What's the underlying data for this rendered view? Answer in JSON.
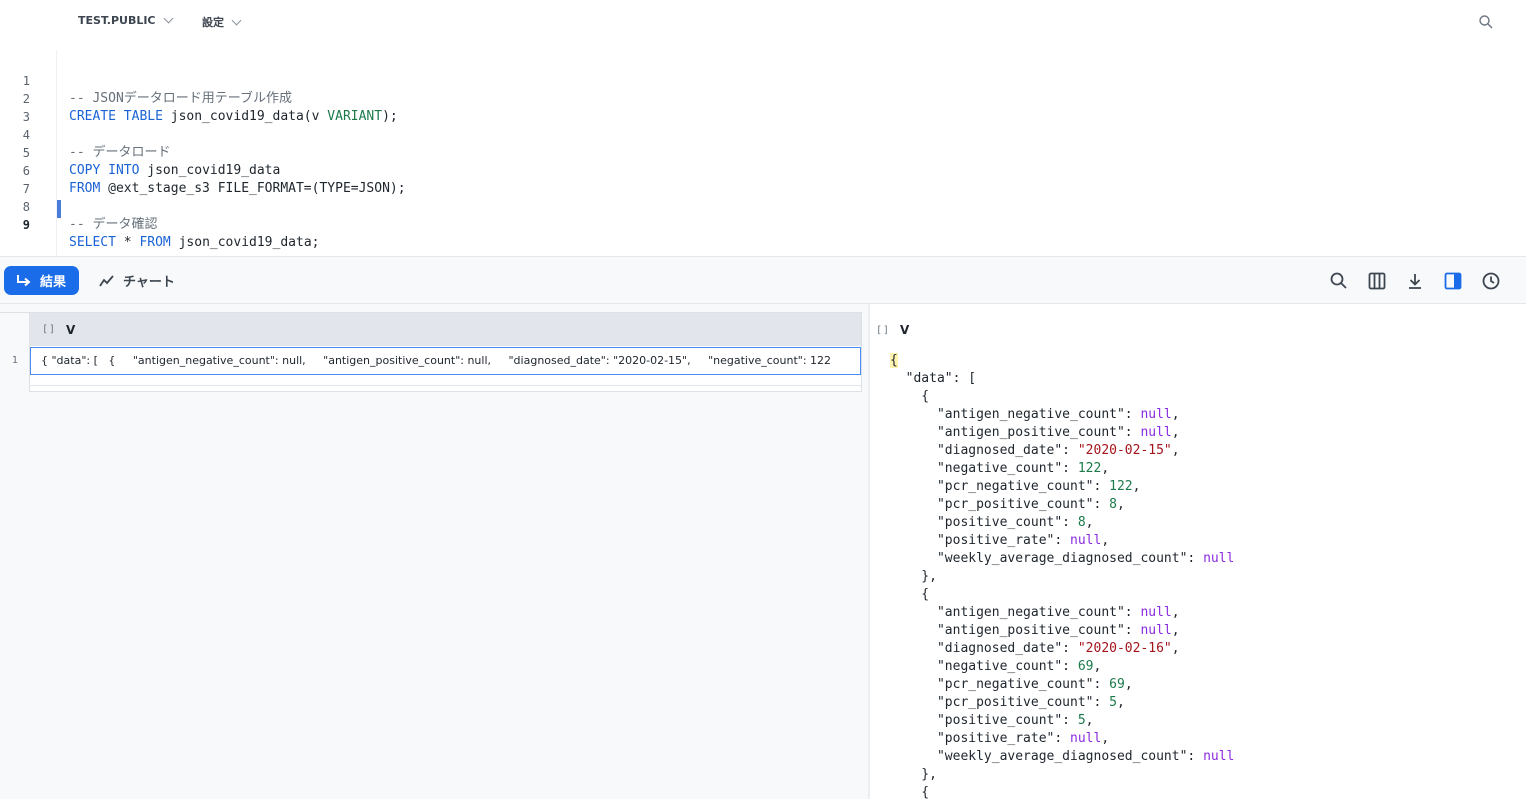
{
  "topbar": {
    "context_label": "TEST.PUBLIC",
    "settings_label": "設定"
  },
  "editor": {
    "lines": [
      {
        "num": "1",
        "text": "-- JSONデータロード用テーブル作成"
      },
      {
        "num": "2",
        "text": "CREATE TABLE json_covid19_data(v VARIANT);"
      },
      {
        "num": "3",
        "text": ""
      },
      {
        "num": "4",
        "text": "-- データロード"
      },
      {
        "num": "5",
        "text": "COPY INTO json_covid19_data"
      },
      {
        "num": "6",
        "text": "FROM @ext_stage_s3 FILE_FORMAT=(TYPE=JSON);"
      },
      {
        "num": "7",
        "text": ""
      },
      {
        "num": "8",
        "text": "-- データ確認"
      },
      {
        "num": "9",
        "text": "SELECT * FROM json_covid19_data;"
      }
    ]
  },
  "toolbar": {
    "results_label": "結果",
    "chart_label": "チャート"
  },
  "grid": {
    "column_type": "[]",
    "column_name": "V",
    "rows": [
      {
        "num": "1",
        "value": "{ \"data\": [   {     \"antigen_negative_count\": null,     \"antigen_positive_count\": null,     \"diagnosed_date\": \"2020-02-15\",     \"negative_count\": 122"
      }
    ]
  },
  "detail": {
    "column_type": "[]",
    "column_name": "V",
    "json_lines": [
      "{",
      "  \"data\": [",
      "    {",
      "      \"antigen_negative_count\": null,",
      "      \"antigen_positive_count\": null,",
      "      \"diagnosed_date\": \"2020-02-15\",",
      "      \"negative_count\": 122,",
      "      \"pcr_negative_count\": 122,",
      "      \"pcr_positive_count\": 8,",
      "      \"positive_count\": 8,",
      "      \"positive_rate\": null,",
      "      \"weekly_average_diagnosed_count\": null",
      "    },",
      "    {",
      "      \"antigen_negative_count\": null,",
      "      \"antigen_positive_count\": null,",
      "      \"diagnosed_date\": \"2020-02-16\",",
      "      \"negative_count\": 69,",
      "      \"pcr_negative_count\": 69,",
      "      \"pcr_positive_count\": 5,",
      "      \"positive_count\": 5,",
      "      \"positive_rate\": null,",
      "      \"weekly_average_diagnosed_count\": null",
      "    },",
      "    {"
    ]
  },
  "colors": {
    "accent": "#1a6ce8",
    "keyword": "#1a63d6",
    "type": "#1c7a4a",
    "comment": "#66707a",
    "json_null": "#8a2be2",
    "json_string": "#a3151c",
    "json_number": "#1c7a4a"
  },
  "icons": [
    "chevron-down-icon",
    "search-icon",
    "results-arrow-icon",
    "chart-line-icon",
    "columns-icon",
    "download-icon",
    "split-panel-icon",
    "history-icon"
  ]
}
